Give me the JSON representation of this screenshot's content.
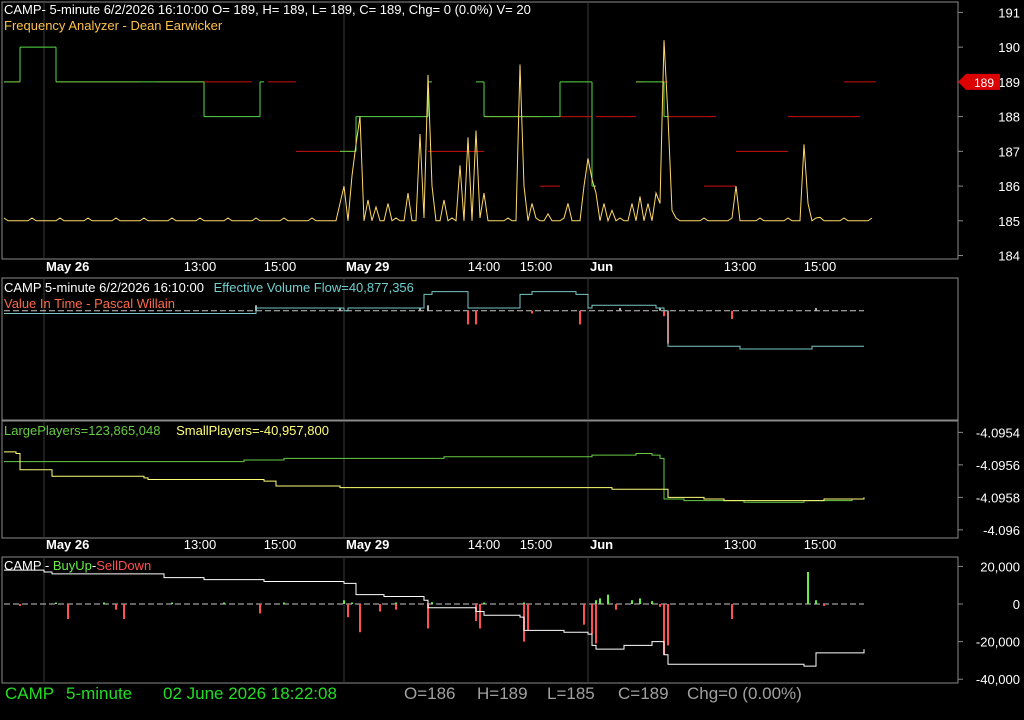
{
  "colors": {
    "background": "#000000",
    "panel_border": "#8a8a8a",
    "grid": "#3a3a3a",
    "axis_text": "#ffffff",
    "freq_price_line": "#ffd966",
    "freq_green": "#55dd44",
    "freq_red": "#cc1111",
    "evf_line": "#78c8c8",
    "evf_pos_bar": "#b0b0b0",
    "evf_neg_bar": "#ff5050",
    "large_players": "#66cc44",
    "small_players": "#ffff77",
    "buyup": "#66ee44",
    "selldown": "#ff5050",
    "cum_line": "#ffffff",
    "status_green": "#22dd22",
    "status_gray": "#a0a0a0",
    "price_marker": "#dd0000"
  },
  "panel1": {
    "header": "CAMP- 5-minute 6/2/2026 16:10:00 O= 189, H= 189, L= 189, C= 189, Chg= 0 (0.0%) V= 20",
    "indicator": "Frequency Analyzer - Dean Earwicker",
    "price_marker": "189"
  },
  "panel2": {
    "header": "CAMP 5-minute  6/2/2026 16:10:00",
    "evf_label": "Effective Volume Flow=40,877,356",
    "indicator": "Value In Time - Pascal Willain"
  },
  "panel3": {
    "large_label": "LargePlayers=123,865,048",
    "small_label": "SmallPlayers=-40,957,800"
  },
  "panel4": {
    "title_prefix": "CAMP - ",
    "buy_label": "BuyUp",
    "sep": "-",
    "sell_label": "SellDown"
  },
  "status": {
    "symbol": "CAMP",
    "interval": "5-minute",
    "datetime": "02 June 2026 18:22:08",
    "open": "O=186",
    "high": "H=189",
    "low": "L=185",
    "close": "C=189",
    "change": "Chg=0 (0.00%)"
  },
  "chart_data": [
    {
      "type": "line",
      "title": "Frequency Analyzer - Dean Earwicker",
      "x_tick_labels": [
        "May 26",
        "13:00",
        "15:00",
        "May 29",
        "14:00",
        "15:00",
        "Jun",
        "13:00",
        "15:00"
      ],
      "x_tick_index": [
        10,
        49,
        69,
        85,
        120,
        133,
        146,
        184,
        204
      ],
      "n_bars": 218,
      "ylim": [
        183.9,
        191.3
      ],
      "y_ticks": [
        184,
        185,
        186,
        187,
        188,
        189,
        190,
        191
      ],
      "series": [
        {
          "name": "Close price",
          "color": "#ffd966",
          "baseline": 185,
          "spikes": [
            [
              84,
              185.5
            ],
            [
              85,
              186
            ],
            [
              87,
              186.3
            ],
            [
              88,
              187.2
            ],
            [
              89,
              188
            ],
            [
              91,
              185.6
            ],
            [
              93,
              185.4
            ],
            [
              96,
              185.5
            ],
            [
              101,
              185.8
            ],
            [
              104,
              187.5
            ],
            [
              106,
              189.2
            ],
            [
              107,
              186
            ],
            [
              110,
              185.6
            ],
            [
              114,
              186.6
            ],
            [
              116,
              187.4
            ],
            [
              118,
              187.6
            ],
            [
              120,
              185.8
            ],
            [
              129,
              189.5
            ],
            [
              130,
              186
            ],
            [
              132,
              185.5
            ],
            [
              136,
              185.2
            ],
            [
              141,
              185.5
            ],
            [
              145,
              186
            ],
            [
              146,
              186.8
            ],
            [
              147,
              186.2
            ],
            [
              148,
              185.8
            ],
            [
              150,
              185.5
            ],
            [
              152,
              185.3
            ],
            [
              157,
              185.5
            ],
            [
              159,
              185.7
            ],
            [
              161,
              185.5
            ],
            [
              163,
              185.8
            ],
            [
              164,
              185.5
            ],
            [
              165,
              190.2
            ],
            [
              166,
              188
            ],
            [
              167,
              185.3
            ],
            [
              183,
              186
            ],
            [
              200,
              187.2
            ],
            [
              201,
              185.5
            ],
            [
              204,
              185.1
            ]
          ]
        },
        {
          "name": "Green frequency level",
          "color": "#55dd44",
          "segments": [
            [
              0,
              4,
              189
            ],
            [
              4,
              13,
              190
            ],
            [
              13,
              50,
              189
            ],
            [
              50,
              64,
              188
            ],
            [
              64,
              65,
              189
            ],
            [
              84,
              88,
              187
            ],
            [
              88,
              106,
              188
            ],
            [
              106,
              107,
              189
            ],
            [
              118,
              120,
              189
            ],
            [
              120,
              139,
              188
            ],
            [
              139,
              147,
              189
            ],
            [
              147,
              148,
              186
            ],
            [
              158,
              165,
              189
            ],
            [
              165,
              166,
              188
            ]
          ]
        },
        {
          "name": "Red frequency level",
          "color": "#cc1111",
          "segments": [
            [
              0,
              4,
              189
            ],
            [
              13,
              34,
              189
            ],
            [
              38,
              62,
              189
            ],
            [
              66,
              73,
              189
            ],
            [
              73,
              88,
              187
            ],
            [
              106,
              120,
              187
            ],
            [
              120,
              134,
              188
            ],
            [
              134,
              139,
              186
            ],
            [
              139,
              147,
              188
            ],
            [
              148,
              158,
              188
            ],
            [
              158,
              160,
              189
            ],
            [
              165,
              166,
              189
            ],
            [
              166,
              178,
              188
            ],
            [
              175,
              183,
              186
            ],
            [
              183,
              196,
              187
            ],
            [
              196,
              214,
              188
            ],
            [
              210,
              218,
              189
            ]
          ]
        }
      ]
    },
    {
      "type": "line",
      "title": "Value In Time - Pascal Willain",
      "x_tick_index": [
        10,
        49,
        69,
        85,
        120,
        133,
        146,
        184,
        204
      ],
      "n_bars": 218,
      "ylim": [
        -40,
        12
      ],
      "series": [
        {
          "name": "Effective Volume Flow",
          "color": "#78c8c8",
          "points": [
            [
              0,
              -1
            ],
            [
              45,
              -1
            ],
            [
              62,
              -1
            ],
            [
              63,
              1
            ],
            [
              85,
              0
            ],
            [
              86,
              1
            ],
            [
              104,
              1
            ],
            [
              105,
              6
            ],
            [
              107,
              7
            ],
            [
              115,
              7
            ],
            [
              116,
              1
            ],
            [
              128,
              1
            ],
            [
              129,
              6
            ],
            [
              132,
              7
            ],
            [
              143,
              6
            ],
            [
              146,
              1
            ],
            [
              147,
              2
            ],
            [
              160,
              2
            ],
            [
              163,
              1
            ],
            [
              165,
              0
            ],
            [
              166,
              -13
            ],
            [
              182,
              -13
            ],
            [
              184,
              -14
            ],
            [
              200,
              -14
            ],
            [
              202,
              -13
            ],
            [
              215,
              -13
            ]
          ]
        },
        {
          "name": "Value In Time",
          "color": "#b0b0b0",
          "bars": [
            [
              63,
              2
            ],
            [
              84,
              1
            ],
            [
              104,
              1
            ],
            [
              106,
              2
            ],
            [
              116,
              -5
            ],
            [
              118,
              -5
            ],
            [
              132,
              -1
            ],
            [
              144,
              -5
            ],
            [
              154,
              1
            ],
            [
              164,
              1
            ],
            [
              165,
              -2
            ],
            [
              166,
              -12
            ],
            [
              182,
              -3
            ],
            [
              203,
              1
            ]
          ]
        }
      ]
    },
    {
      "type": "line",
      "title": "",
      "x_tick_labels": [
        "May 26",
        "13:00",
        "15:00",
        "May 29",
        "14:00",
        "15:00",
        "Jun",
        "13:00",
        "15:00"
      ],
      "x_tick_index": [
        10,
        49,
        69,
        85,
        120,
        133,
        146,
        184,
        204
      ],
      "n_bars": 218,
      "ylim": [
        -4.09605,
        -4.09533
      ],
      "y_ticks": [
        -4.0954,
        -4.0956,
        -4.0958,
        -4.096
      ],
      "series": [
        {
          "name": "LargePlayers",
          "color": "#66cc44",
          "points": [
            [
              0,
              -4.09558
            ],
            [
              40,
              -4.09558
            ],
            [
              60,
              -4.09557
            ],
            [
              70,
              -4.09556
            ],
            [
              110,
              -4.09555
            ],
            [
              147,
              -4.09554
            ],
            [
              158,
              -4.09553
            ],
            [
              162,
              -4.09554
            ],
            [
              164,
              -4.09556
            ],
            [
              165,
              -4.09581
            ],
            [
              170,
              -4.09582
            ],
            [
              178,
              -4.09582
            ],
            [
              185,
              -4.09583
            ],
            [
              200,
              -4.09582
            ],
            [
              212,
              -4.09581
            ],
            [
              215,
              -4.0958
            ]
          ]
        },
        {
          "name": "SmallPlayers",
          "color": "#ffff77",
          "points": [
            [
              0,
              -4.09552
            ],
            [
              3,
              -4.09553
            ],
            [
              4,
              -4.09563
            ],
            [
              10,
              -4.09563
            ],
            [
              12,
              -4.09567
            ],
            [
              35,
              -4.09568
            ],
            [
              36,
              -4.09569
            ],
            [
              65,
              -4.0957
            ],
            [
              68,
              -4.09573
            ],
            [
              84,
              -4.09574
            ],
            [
              100,
              -4.09574
            ],
            [
              152,
              -4.09575
            ],
            [
              164,
              -4.09575
            ],
            [
              166,
              -4.0958
            ],
            [
              175,
              -4.09581
            ],
            [
              180,
              -4.09582
            ],
            [
              195,
              -4.09582
            ],
            [
              205,
              -4.09581
            ],
            [
              215,
              -4.0958
            ]
          ]
        }
      ]
    },
    {
      "type": "bar",
      "title": "CAMP - BuyUp-SellDown",
      "x_tick_index": [
        10,
        49,
        69,
        85,
        120,
        133,
        146,
        184,
        204
      ],
      "n_bars": 218,
      "ylim": [
        -42000,
        25000
      ],
      "y_ticks": [
        20000,
        0,
        -20000,
        -40000
      ],
      "series": [
        {
          "name": "BuyUp",
          "color": "#66ee44",
          "bars": [
            [
              13,
              800
            ],
            [
              25,
              800
            ],
            [
              42,
              800
            ],
            [
              55,
              800
            ],
            [
              70,
              800
            ],
            [
              85,
              2000
            ],
            [
              87,
              800
            ],
            [
              98,
              800
            ],
            [
              107,
              1000
            ],
            [
              120,
              800
            ],
            [
              130,
              800
            ],
            [
              148,
              2000
            ],
            [
              149,
              3000
            ],
            [
              151,
              5000
            ],
            [
              157,
              2000
            ],
            [
              159,
              3000
            ],
            [
              162,
              1500
            ],
            [
              201,
              17000
            ],
            [
              203,
              2000
            ]
          ]
        },
        {
          "name": "SellDown",
          "color": "#ff5050",
          "bars": [
            [
              4,
              -1000
            ],
            [
              16,
              -8000
            ],
            [
              28,
              -3000
            ],
            [
              30,
              -8000
            ],
            [
              64,
              -5000
            ],
            [
              86,
              -7000
            ],
            [
              89,
              -15000
            ],
            [
              94,
              -4000
            ],
            [
              98,
              -3000
            ],
            [
              106,
              -13000
            ],
            [
              118,
              -9000
            ],
            [
              119,
              -13000
            ],
            [
              130,
              -20000
            ],
            [
              131,
              -14000
            ],
            [
              145,
              -11000
            ],
            [
              147,
              -16000
            ],
            [
              148,
              -21000
            ],
            [
              153,
              -3000
            ],
            [
              164,
              -1500
            ],
            [
              165,
              -27000
            ],
            [
              166,
              -22000
            ],
            [
              182,
              -8000
            ],
            [
              205,
              -1000
            ]
          ]
        },
        {
          "name": "BuyUp-SellDown",
          "type": "line",
          "color": "#ffffff",
          "points": [
            [
              0,
              18000
            ],
            [
              10,
              17000
            ],
            [
              12,
              16000
            ],
            [
              30,
              16000
            ],
            [
              40,
              14000
            ],
            [
              50,
              13000
            ],
            [
              65,
              12000
            ],
            [
              85,
              11000
            ],
            [
              88,
              5000
            ],
            [
              95,
              4000
            ],
            [
              105,
              2000
            ],
            [
              106,
              -2000
            ],
            [
              118,
              -4000
            ],
            [
              120,
              -6000
            ],
            [
              129,
              -7000
            ],
            [
              130,
              -14000
            ],
            [
              140,
              -15000
            ],
            [
              146,
              -16000
            ],
            [
              147,
              -22000
            ],
            [
              148,
              -24000
            ],
            [
              155,
              -22000
            ],
            [
              162,
              -20000
            ],
            [
              164,
              -20000
            ],
            [
              165,
              -27000
            ],
            [
              166,
              -32000
            ],
            [
              175,
              -32000
            ],
            [
              200,
              -33000
            ],
            [
              203,
              -26000
            ],
            [
              215,
              -24000
            ]
          ]
        }
      ]
    }
  ]
}
